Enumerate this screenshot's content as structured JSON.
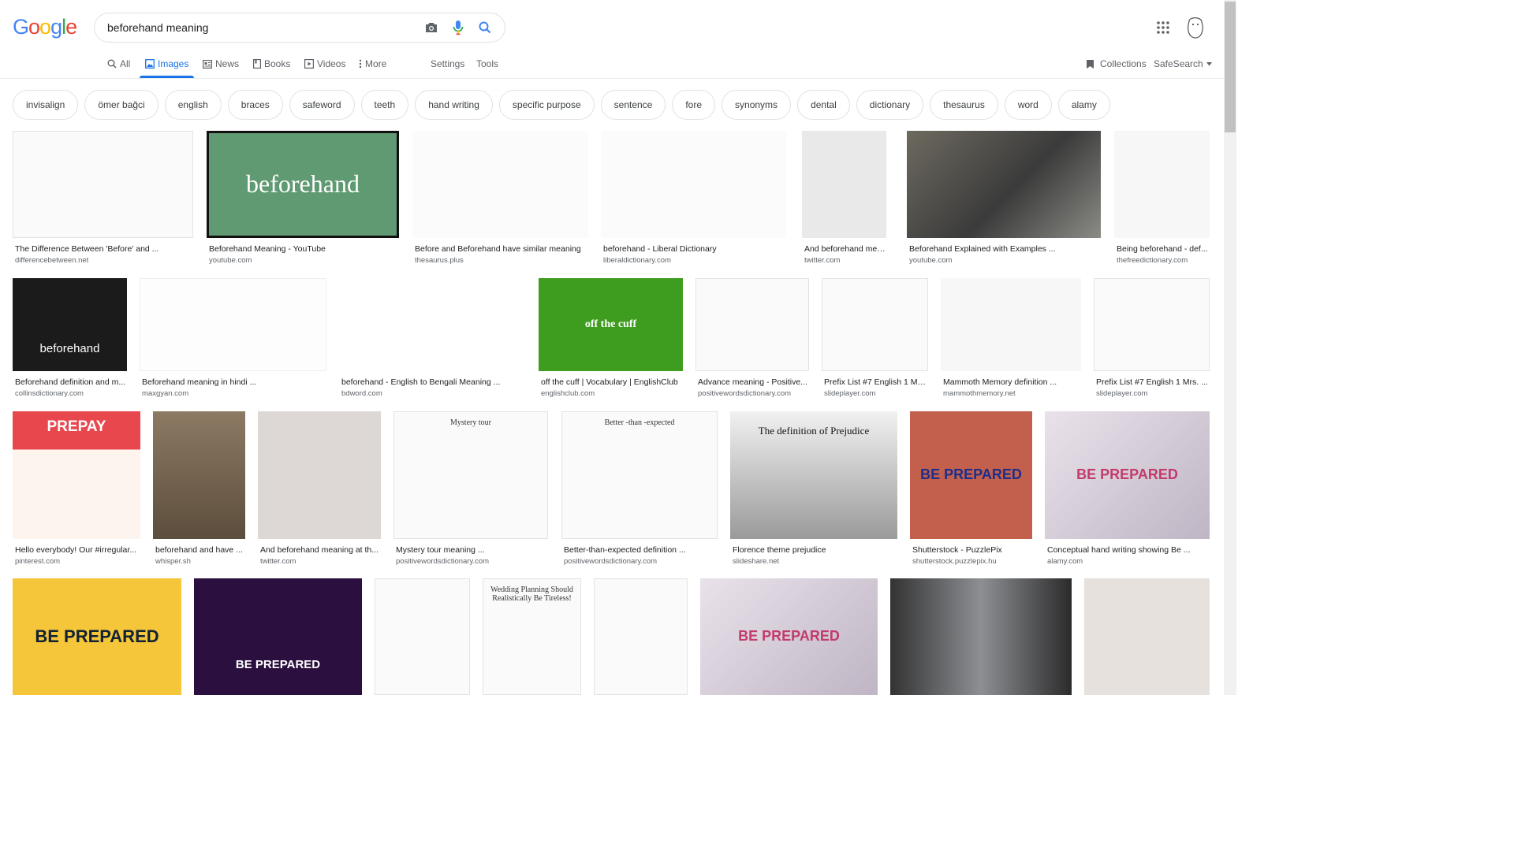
{
  "search": {
    "query": "beforehand meaning"
  },
  "logo_letters": [
    "G",
    "o",
    "o",
    "g",
    "l",
    "e"
  ],
  "tabs": [
    {
      "label": "All"
    },
    {
      "label": "Images"
    },
    {
      "label": "News"
    },
    {
      "label": "Books"
    },
    {
      "label": "Videos"
    },
    {
      "label": "More"
    },
    {
      "label": "Settings"
    },
    {
      "label": "Tools"
    }
  ],
  "right_tools": {
    "collections": "Collections",
    "safesearch": "SafeSearch"
  },
  "chips": [
    "invisalign",
    "ömer bağci",
    "english",
    "braces",
    "safeword",
    "teeth",
    "hand writing",
    "specific purpose",
    "sentence",
    "fore",
    "synonyms",
    "dental",
    "dictionary",
    "thesaurus",
    "word",
    "alamy"
  ],
  "results": [
    {
      "caption": "The Difference Between 'Before' and ...",
      "source": "differencebetween.net"
    },
    {
      "caption": "Beforehand Meaning - YouTube",
      "source": "youtube.com",
      "thumb_text": "beforehand"
    },
    {
      "caption": "Before and Beforehand have similar meaning",
      "source": "thesaurus.plus"
    },
    {
      "caption": "beforehand - Liberal Dictionary",
      "source": "liberaldictionary.com"
    },
    {
      "caption": "And beforehand meani...",
      "source": "twitter.com"
    },
    {
      "caption": "Beforehand Explained with Examples ...",
      "source": "youtube.com"
    },
    {
      "caption": "Being beforehand - def...",
      "source": "thefreedictionary.com"
    },
    {
      "caption": "Beforehand definition and m...",
      "source": "collinsdictionary.com",
      "thumb_text": "beforehand"
    },
    {
      "caption": "Beforehand meaning in hindi ...",
      "source": "maxgyan.com"
    },
    {
      "caption": "beforehand - English to Bengali Meaning ...",
      "source": "bdword.com"
    },
    {
      "caption": "off the cuff | Vocabulary | EnglishClub",
      "source": "englishclub.com",
      "thumb_text": "off the cuff"
    },
    {
      "caption": "Advance meaning - Positive...",
      "source": "positivewordsdictionary.com"
    },
    {
      "caption": "Prefix List #7 English 1 Mr....",
      "source": "slideplayer.com"
    },
    {
      "caption": "Mammoth Memory definition ...",
      "source": "mammothmemory.net"
    },
    {
      "caption": "Prefix List #7 English 1 Mrs. ...",
      "source": "slideplayer.com"
    },
    {
      "caption": "Hello everybody! Our #irregular...",
      "source": "pinterest.com",
      "thumb_text": "PREPAY"
    },
    {
      "caption": "beforehand and have ...",
      "source": "whisper.sh"
    },
    {
      "caption": "And beforehand meaning at th...",
      "source": "twitter.com"
    },
    {
      "caption": "Mystery tour meaning ...",
      "source": "positivewordsdictionary.com",
      "thumb_text": "Mystery tour"
    },
    {
      "caption": "Better-than-expected definition ...",
      "source": "positivewordsdictionary.com",
      "thumb_text": "Better -than -expected"
    },
    {
      "caption": "Florence theme prejudice",
      "source": "slideshare.net",
      "thumb_text": "The definition of Prejudice"
    },
    {
      "caption": "Shutterstock - PuzzlePix",
      "source": "shutterstock.puzzlepix.hu",
      "thumb_text": "BE PREPARED"
    },
    {
      "caption": "Conceptual hand writing showing Be ...",
      "source": "alamy.com",
      "thumb_text": "BE PREPARED"
    },
    {
      "thumb_text": "BE PREPARED"
    },
    {
      "thumb_text": "BE PREPARED"
    },
    {},
    {
      "thumb_text": "Wedding Planning Should Realistically Be Tireless!"
    },
    {},
    {
      "thumb_text": "BE PREPARED"
    },
    {},
    {}
  ],
  "colors": {
    "accent": "#1a73e8",
    "chip_border": "#dfe1e5",
    "text_secondary": "#5f6368"
  }
}
